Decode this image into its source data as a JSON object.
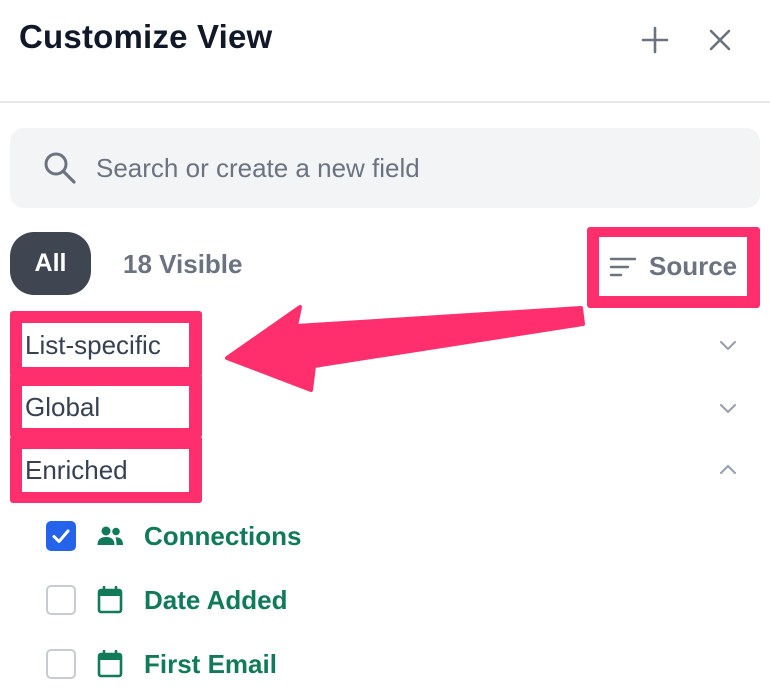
{
  "header": {
    "title": "Customize View",
    "add_icon": "plus-icon",
    "close_icon": "close-icon"
  },
  "search": {
    "placeholder": "Search or create a new field",
    "value": "",
    "icon": "search-icon"
  },
  "filter": {
    "all_label": "All",
    "visible_label": "18 Visible",
    "source_label": "Source",
    "source_icon": "sort-lines-icon"
  },
  "groups": [
    {
      "label": "List-specific",
      "expanded": false
    },
    {
      "label": "Global",
      "expanded": false
    },
    {
      "label": "Enriched",
      "expanded": true
    }
  ],
  "fields": [
    {
      "label": "Connections",
      "checked": true,
      "icon": "people-icon"
    },
    {
      "label": "Date Added",
      "checked": false,
      "icon": "calendar-icon"
    },
    {
      "label": "First Email",
      "checked": false,
      "icon": "calendar-icon"
    }
  ],
  "colors": {
    "annotation": "#ff2f6e",
    "field_text": "#117a58",
    "checkbox_checked": "#2563eb",
    "pill_bg": "#3f4652"
  }
}
